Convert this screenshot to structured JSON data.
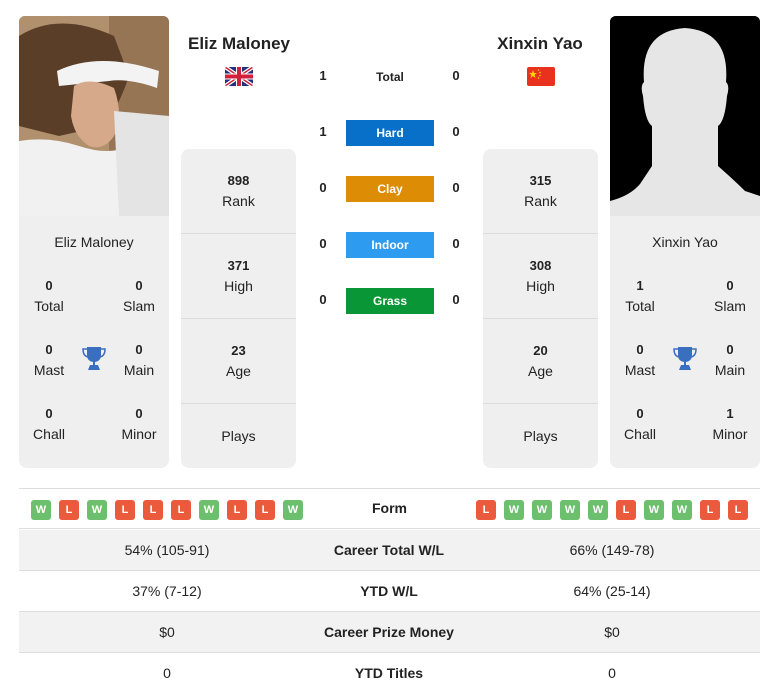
{
  "players": {
    "left": {
      "name": "Eliz Maloney",
      "country_flag": "united-kingdom-flag",
      "photo": "player-photo",
      "rank": "898",
      "rank_label": "Rank",
      "high": "371",
      "high_label": "High",
      "age": "23",
      "age_label": "Age",
      "plays_label": "Plays",
      "titles": {
        "total": "0",
        "total_label": "Total",
        "slam": "0",
        "slam_label": "Slam",
        "mast": "0",
        "mast_label": "Mast",
        "main": "0",
        "main_label": "Main",
        "chall": "0",
        "chall_label": "Chall",
        "minor": "0",
        "minor_label": "Minor"
      },
      "form": [
        "W",
        "L",
        "W",
        "L",
        "L",
        "L",
        "W",
        "L",
        "L",
        "W"
      ]
    },
    "right": {
      "name": "Xinxin Yao",
      "country_flag": "china-flag",
      "photo": "silhouette-placeholder",
      "rank": "315",
      "rank_label": "Rank",
      "high": "308",
      "high_label": "High",
      "age": "20",
      "age_label": "Age",
      "plays_label": "Plays",
      "titles": {
        "total": "1",
        "total_label": "Total",
        "slam": "0",
        "slam_label": "Slam",
        "mast": "0",
        "mast_label": "Mast",
        "main": "0",
        "main_label": "Main",
        "chall": "0",
        "chall_label": "Chall",
        "minor": "1",
        "minor_label": "Minor"
      },
      "form": [
        "L",
        "W",
        "W",
        "W",
        "W",
        "L",
        "W",
        "W",
        "L",
        "L"
      ]
    }
  },
  "h2h": {
    "total": {
      "label": "Total",
      "left": "1",
      "right": "0"
    },
    "surfaces": [
      {
        "label": "Hard",
        "left": "1",
        "right": "0",
        "color": "#0870c8"
      },
      {
        "label": "Clay",
        "left": "0",
        "right": "0",
        "color": "#dd8c06"
      },
      {
        "label": "Indoor",
        "left": "0",
        "right": "0",
        "color": "#2d9cf0"
      },
      {
        "label": "Grass",
        "left": "0",
        "right": "0",
        "color": "#099636"
      }
    ]
  },
  "comparison": {
    "form_label": "Form",
    "rows": [
      {
        "label": "Career Total W/L",
        "left": "54% (105-91)",
        "right": "66% (149-78)"
      },
      {
        "label": "YTD W/L",
        "left": "37% (7-12)",
        "right": "64% (25-14)"
      },
      {
        "label": "Career Prize Money",
        "left": "$0",
        "right": "$0"
      },
      {
        "label": "YTD Titles",
        "left": "0",
        "right": "0"
      }
    ]
  },
  "colors": {
    "win": "#6cbf6c",
    "loss": "#ec5a3e",
    "trophy": "#3a6fc0",
    "card_bg": "#efefef"
  }
}
